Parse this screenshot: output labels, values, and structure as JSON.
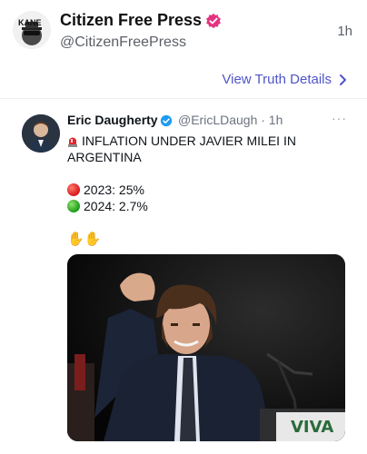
{
  "post": {
    "author_name": "Citizen Free Press",
    "handle": "@CitizenFreePress",
    "time": "1h",
    "avatar_text": "KANE",
    "view_details_label": "View Truth Details"
  },
  "quoted": {
    "name": "Eric Daugherty",
    "handle": "@EricLDaugh · 1h",
    "more": "···",
    "headline_line1": "INFLATION UNDER JAVIER MILEI IN",
    "headline_line2": "ARGENTINA",
    "stat1": "2023: 25%",
    "stat2": "2024: 2.7%",
    "photo_sign_text": "VIVA"
  },
  "colors": {
    "verified_pink": "#e5337f",
    "verified_blue": "#1d9bf0",
    "link": "#4f55c9"
  }
}
